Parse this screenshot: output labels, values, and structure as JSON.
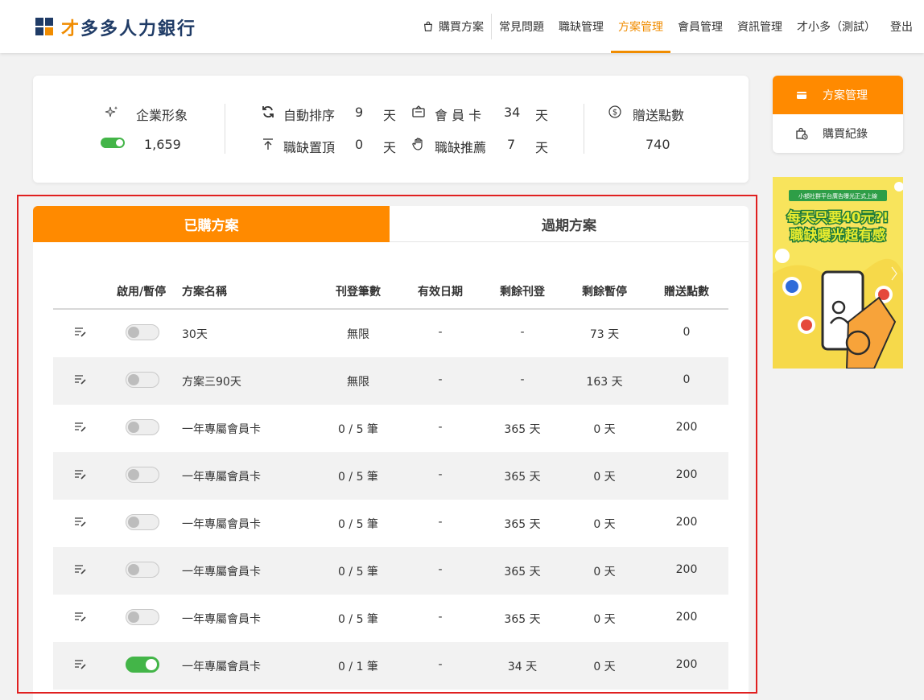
{
  "header": {
    "logo_prefix": "才",
    "logo_rest": "多多人力銀行",
    "nav": [
      {
        "label": "購買方案"
      },
      {
        "label": "常見問題"
      },
      {
        "label": "職缺管理"
      },
      {
        "label": "方案管理"
      },
      {
        "label": "會員管理"
      },
      {
        "label": "資訊管理"
      },
      {
        "label": "才小多（測試）"
      },
      {
        "label": "登出"
      }
    ]
  },
  "summary": {
    "image_label": "企業形象",
    "image_value": "1,659",
    "auto_sort_label": "自動排序",
    "auto_sort_value": "9",
    "top_label": "職缺置頂",
    "top_value": "0",
    "member_card_label": "會 員 卡",
    "member_card_value": "34",
    "recommend_label": "職缺推薦",
    "recommend_value": "7",
    "day_unit": "天",
    "points_label": "贈送點數",
    "points_value": "740"
  },
  "right_menu": {
    "items": [
      {
        "label": "方案管理"
      },
      {
        "label": "購買紀錄"
      }
    ]
  },
  "banner": {
    "top_text": "小額社群平台廣告曝光正式上線",
    "line1": "每天只要40元?!",
    "line2": "職缺曝光超有感"
  },
  "tabs": {
    "active": "已購方案",
    "inactive": "過期方案"
  },
  "table": {
    "headers": {
      "toggle": "啟用/暫停",
      "name": "方案名稱",
      "posts": "刊登筆數",
      "expiry": "有效日期",
      "remaining_post": "剩餘刊登",
      "remaining_pause": "剩餘暫停",
      "points": "贈送點數"
    },
    "rows": [
      {
        "enabled": false,
        "name": "30天",
        "posts": "無限",
        "expiry": "-",
        "remaining_post": "-",
        "remaining_pause": "73 天",
        "points": "0"
      },
      {
        "enabled": false,
        "name": "方案三90天",
        "posts": "無限",
        "expiry": "-",
        "remaining_post": "-",
        "remaining_pause": "163 天",
        "points": "0"
      },
      {
        "enabled": false,
        "name": "一年專屬會員卡",
        "posts": "0 / 5 筆",
        "expiry": "-",
        "remaining_post": "365 天",
        "remaining_pause": "0 天",
        "points": "200"
      },
      {
        "enabled": false,
        "name": "一年專屬會員卡",
        "posts": "0 / 5 筆",
        "expiry": "-",
        "remaining_post": "365 天",
        "remaining_pause": "0 天",
        "points": "200"
      },
      {
        "enabled": false,
        "name": "一年專屬會員卡",
        "posts": "0 / 5 筆",
        "expiry": "-",
        "remaining_post": "365 天",
        "remaining_pause": "0 天",
        "points": "200"
      },
      {
        "enabled": false,
        "name": "一年專屬會員卡",
        "posts": "0 / 5 筆",
        "expiry": "-",
        "remaining_post": "365 天",
        "remaining_pause": "0 天",
        "points": "200"
      },
      {
        "enabled": false,
        "name": "一年專屬會員卡",
        "posts": "0 / 5 筆",
        "expiry": "-",
        "remaining_post": "365 天",
        "remaining_pause": "0 天",
        "points": "200"
      },
      {
        "enabled": true,
        "name": "一年專屬會員卡",
        "posts": "0 / 1 筆",
        "expiry": "-",
        "remaining_post": "34 天",
        "remaining_pause": "0 天",
        "points": "200"
      }
    ]
  },
  "colors": {
    "accent": "#ff8a00",
    "brand_navy": "#1f3b66",
    "toggle_on": "#43b548",
    "highlight": "#e02020"
  }
}
